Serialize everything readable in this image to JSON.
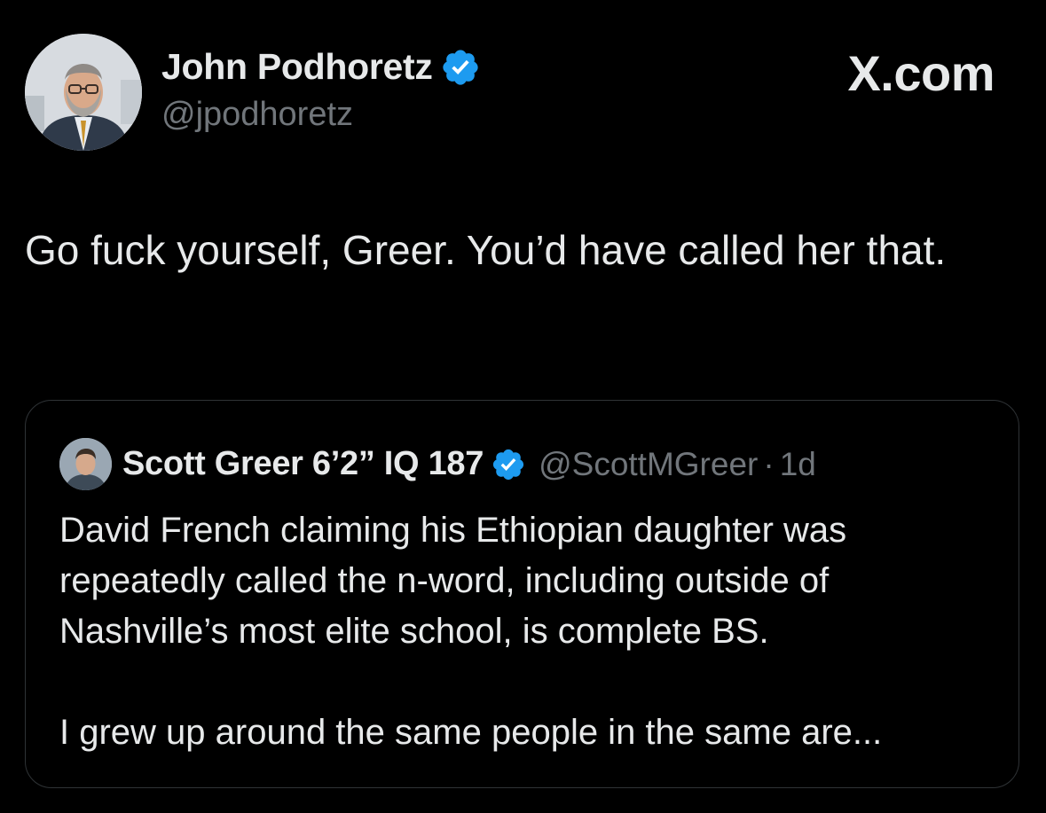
{
  "tweet": {
    "author": {
      "name": "John Podhoretz",
      "handle": "@jpodhoretz",
      "verified": true,
      "avatar_icon": "profile-photo-man-glasses"
    },
    "text": "Go fuck yourself, Greer. You’d have called her that."
  },
  "brand": {
    "label": "X.com"
  },
  "quote": {
    "author": {
      "name": "Scott Greer 6’2” IQ 187",
      "handle": "@ScottMGreer",
      "verified": true,
      "avatar_icon": "profile-photo-man"
    },
    "separator": "·",
    "time": "1d",
    "text_paragraph_1": "David French claiming his Ethiopian daughter was repeatedly called the n-word, including outside of Nashville’s most elite school, is complete BS.",
    "text_paragraph_2": "I grew up around the same people in the same are..."
  },
  "colors": {
    "background": "#000000",
    "primary_text": "#e7e9ea",
    "secondary_text": "#71767b",
    "verified_badge": "#1d9bf0",
    "card_border": "#2f3336"
  }
}
